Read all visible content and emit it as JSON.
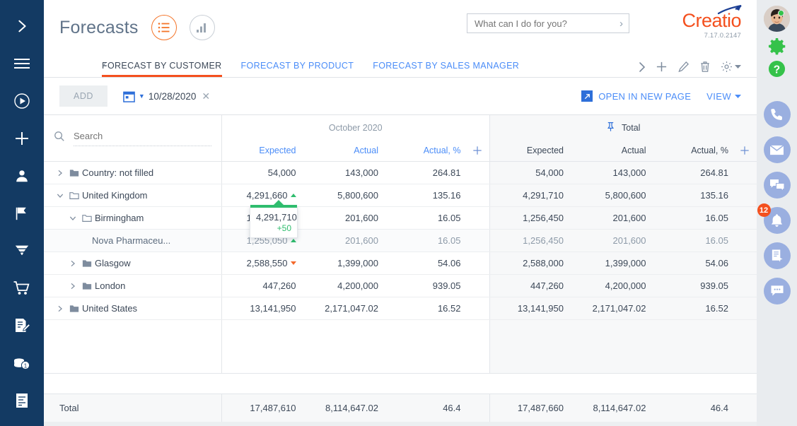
{
  "header": {
    "title": "Forecasts",
    "view_list_icon": "list-view-icon",
    "view_chart_icon": "chart-view-icon",
    "assistant_placeholder": "What can I do for you?",
    "brand_name": "Creatio",
    "brand_version": "7.17.0.2147",
    "accent_color": "#f4501e",
    "link_color": "#4b8df8"
  },
  "tabs": [
    {
      "label": "FORECAST BY CUSTOMER",
      "active": true
    },
    {
      "label": "FORECAST BY PRODUCT",
      "active": false
    },
    {
      "label": "FORECAST BY SALES MANAGER",
      "active": false
    }
  ],
  "tab_actions": [
    {
      "name": "next-tab-chevron-icon"
    },
    {
      "name": "add-icon"
    },
    {
      "name": "edit-pencil-icon"
    },
    {
      "name": "delete-trash-icon"
    },
    {
      "name": "settings-gear-icon"
    }
  ],
  "toolbar": {
    "add_label": "ADD",
    "date_value": "10/28/2020",
    "open_in_new_page_label": "OPEN IN NEW PAGE",
    "view_label": "VIEW"
  },
  "grid": {
    "search_placeholder": "Search",
    "groups": [
      {
        "title": "October 2020",
        "pinned": false,
        "columns": [
          "Expected",
          "Actual",
          "Actual, %"
        ]
      },
      {
        "title": "Total",
        "pinned": true,
        "columns": [
          "Expected",
          "Actual",
          "Actual, %"
        ]
      }
    ],
    "rows": [
      {
        "label": "Country: not filled",
        "level": 0,
        "expanded": false,
        "folder": "closed",
        "has_twisty": true,
        "dim": false,
        "period": [
          "54,000",
          "143,000",
          "264.81"
        ],
        "total": [
          "54,000",
          "143,000",
          "264.81"
        ],
        "trend": ""
      },
      {
        "label": "United Kingdom",
        "level": 0,
        "expanded": true,
        "folder": "open",
        "has_twisty": true,
        "dim": false,
        "period": [
          "4,291,660",
          "5,800,600",
          "135.16"
        ],
        "total": [
          "4,291,710",
          "5,800,600",
          "135.16"
        ],
        "trend": "up"
      },
      {
        "label": "Birmingham",
        "level": 1,
        "expanded": true,
        "folder": "open",
        "has_twisty": true,
        "dim": false,
        "period": [
          "1,256,450",
          "201,600",
          "16.05"
        ],
        "total": [
          "1,256,450",
          "201,600",
          "16.05"
        ],
        "trend": "up"
      },
      {
        "label": "Nova Pharmaceu...",
        "level": 3,
        "expanded": false,
        "folder": "none",
        "has_twisty": false,
        "dim": true,
        "period": [
          "1,255,050",
          "201,600",
          "16.05"
        ],
        "total": [
          "1,256,450",
          "201,600",
          "16.05"
        ],
        "trend": "up"
      },
      {
        "label": "Glasgow",
        "level": 1,
        "expanded": false,
        "folder": "closed",
        "has_twisty": true,
        "dim": false,
        "period": [
          "2,588,550",
          "1,399,000",
          "54.06"
        ],
        "total": [
          "2,588,000",
          "1,399,000",
          "54.06"
        ],
        "trend": "down"
      },
      {
        "label": "London",
        "level": 1,
        "expanded": false,
        "folder": "closed",
        "has_twisty": true,
        "dim": false,
        "period": [
          "447,260",
          "4,200,000",
          "939.05"
        ],
        "total": [
          "447,260",
          "4,200,000",
          "939.05"
        ],
        "trend": ""
      },
      {
        "label": "United States",
        "level": 0,
        "expanded": false,
        "folder": "closed",
        "has_twisty": true,
        "dim": false,
        "period": [
          "13,141,950",
          "2,171,047.02",
          "16.52"
        ],
        "total": [
          "13,141,950",
          "2,171,047.02",
          "16.52"
        ],
        "trend": ""
      }
    ],
    "footer": {
      "label": "Total",
      "period": [
        "17,487,610",
        "8,114,647.02",
        "46.4"
      ],
      "total": [
        "17,487,660",
        "8,114,647.02",
        "46.4"
      ]
    },
    "tooltip": {
      "value": "4,291,710",
      "delta": "+50",
      "color": "#2fbd6e"
    }
  },
  "left_nav": [
    {
      "name": "expand-panel-chevron-icon"
    },
    {
      "name": "hamburger-menu-icon"
    },
    {
      "name": "run-process-icon"
    },
    {
      "name": "add-icon"
    },
    {
      "name": "contacts-icon"
    },
    {
      "name": "flag-icon"
    },
    {
      "name": "funnel-icon"
    },
    {
      "name": "cart-icon"
    },
    {
      "name": "orders-edit-icon"
    },
    {
      "name": "invoices-coins-icon"
    },
    {
      "name": "documents-icon"
    }
  ],
  "right_rail": {
    "avatar_name": "user-avatar",
    "online": true,
    "gear_icon": "settings-gear-icon",
    "help_icon": "help-question-icon",
    "buttons": [
      {
        "name": "phone-call-icon",
        "badge": ""
      },
      {
        "name": "email-icon",
        "badge": ""
      },
      {
        "name": "chat-bubbles-icon",
        "badge": ""
      },
      {
        "name": "notifications-bell-icon",
        "badge": "12"
      },
      {
        "name": "feed-actions-icon",
        "badge": ""
      },
      {
        "name": "message-icon",
        "badge": ""
      }
    ]
  }
}
